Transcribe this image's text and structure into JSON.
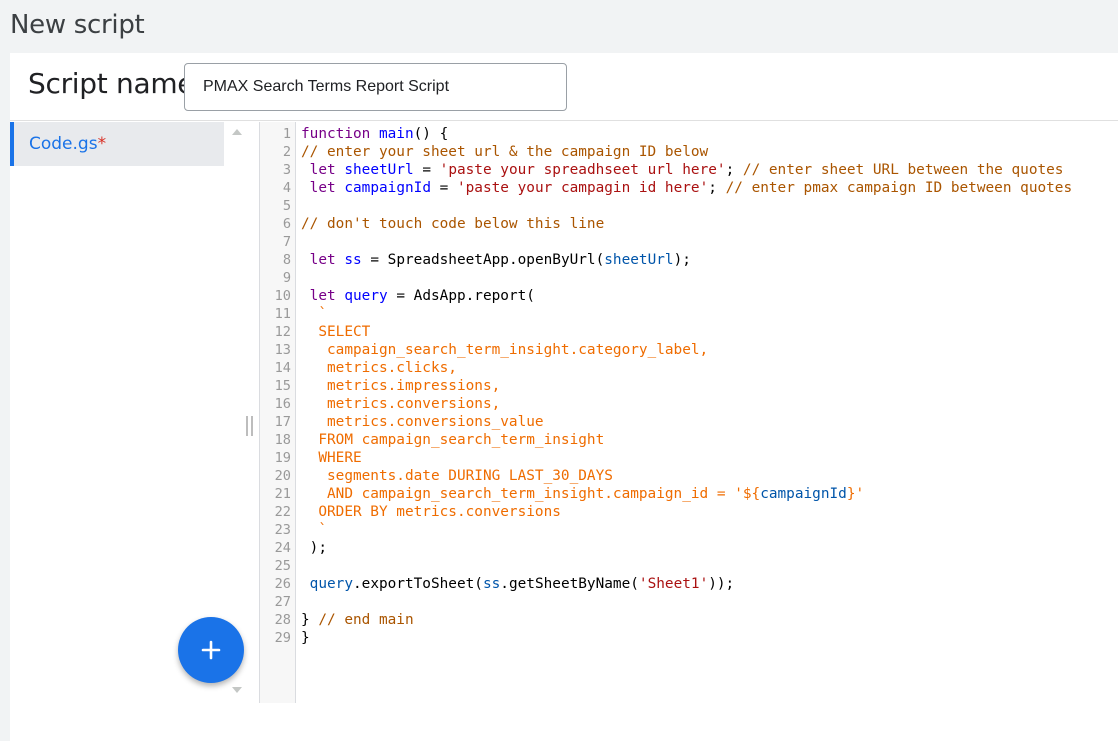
{
  "page": {
    "title": "New script"
  },
  "script_name": {
    "label": "Script name:",
    "value": "PMAX Search Terms Report Script"
  },
  "files": [
    {
      "name": "Code.gs",
      "dirty_marker": "*"
    }
  ],
  "fab": {
    "icon": "plus-icon"
  },
  "editor": {
    "lines": [
      [
        [
          "kw",
          "function"
        ],
        [
          "",
          " "
        ],
        [
          "def",
          "main"
        ],
        [
          "",
          "() {"
        ]
      ],
      [
        [
          "cmt",
          "// enter your sheet url & the campaign ID below"
        ]
      ],
      [
        [
          "",
          " "
        ],
        [
          "kw",
          "let"
        ],
        [
          "",
          " "
        ],
        [
          "def",
          "sheetUrl"
        ],
        [
          "",
          " = "
        ],
        [
          "str",
          "'paste your spreadhseet url here'"
        ],
        [
          "",
          "; "
        ],
        [
          "cmt",
          "// enter sheet URL between the quotes"
        ]
      ],
      [
        [
          "",
          " "
        ],
        [
          "kw",
          "let"
        ],
        [
          "",
          " "
        ],
        [
          "def",
          "campaignId"
        ],
        [
          "",
          " = "
        ],
        [
          "str",
          "'paste your campagin id here'"
        ],
        [
          "",
          "; "
        ],
        [
          "cmt",
          "// enter pmax campaign ID between quotes"
        ]
      ],
      [],
      [
        [
          "cmt",
          "// don't touch code below this line"
        ]
      ],
      [],
      [
        [
          "",
          " "
        ],
        [
          "kw",
          "let"
        ],
        [
          "",
          " "
        ],
        [
          "def",
          "ss"
        ],
        [
          "",
          " = SpreadsheetApp.openByUrl("
        ],
        [
          "var",
          "sheetUrl"
        ],
        [
          "",
          ");"
        ]
      ],
      [],
      [
        [
          "",
          " "
        ],
        [
          "kw",
          "let"
        ],
        [
          "",
          " "
        ],
        [
          "def",
          "query"
        ],
        [
          "",
          " = AdsApp.report("
        ]
      ],
      [
        [
          "sql",
          "  `"
        ]
      ],
      [
        [
          "sql",
          "  SELECT"
        ]
      ],
      [
        [
          "sql",
          "   campaign_search_term_insight.category_label,"
        ]
      ],
      [
        [
          "sql",
          "   metrics.clicks,"
        ]
      ],
      [
        [
          "sql",
          "   metrics.impressions,"
        ]
      ],
      [
        [
          "sql",
          "   metrics.conversions,"
        ]
      ],
      [
        [
          "sql",
          "   metrics.conversions_value"
        ]
      ],
      [
        [
          "sql",
          "  FROM campaign_search_term_insight"
        ]
      ],
      [
        [
          "sql",
          "  WHERE"
        ]
      ],
      [
        [
          "sql",
          "   segments.date DURING LAST_30_DAYS"
        ]
      ],
      [
        [
          "sql",
          "   AND campaign_search_term_insight.campaign_id = '${"
        ],
        [
          "var",
          "campaignId"
        ],
        [
          "sql",
          "}'"
        ]
      ],
      [
        [
          "sql",
          "  ORDER BY metrics.conversions"
        ]
      ],
      [
        [
          "sql",
          "  `"
        ]
      ],
      [
        [
          "",
          " );"
        ]
      ],
      [],
      [
        [
          "",
          " "
        ],
        [
          "var",
          "query"
        ],
        [
          "",
          ".exportToSheet("
        ],
        [
          "var",
          "ss"
        ],
        [
          "",
          ".getSheetByName("
        ],
        [
          "str",
          "'Sheet1'"
        ],
        [
          "",
          "));"
        ]
      ],
      [],
      [
        [
          "",
          "} "
        ],
        [
          "cmt",
          "// end main"
        ]
      ],
      [
        [
          "",
          "}"
        ]
      ]
    ]
  }
}
